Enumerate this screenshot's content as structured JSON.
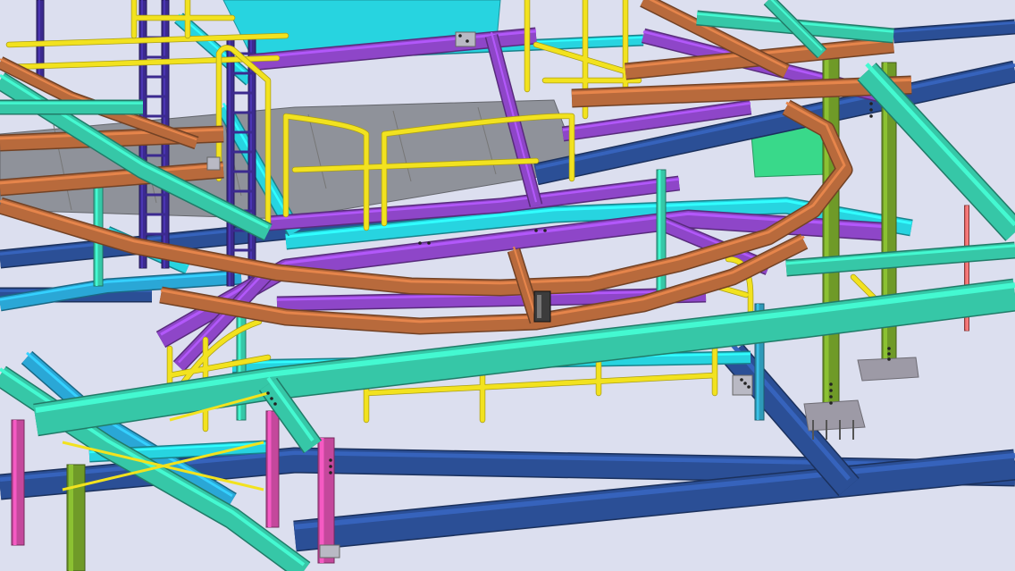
{
  "viewport": {
    "kind": "3D steel structure model view",
    "background_color": "#dcdfef"
  },
  "member_colors": {
    "deck_plate": "#8f929a",
    "handrail": "#f2e21f",
    "curved_beam": "#b86a3c",
    "secondary_beam": "#8e46c8",
    "primary_beam": "#36c7a7",
    "cross_beam": "#27d4e0",
    "base_beam": "#2b4f96",
    "column_olive": "#6f9a28",
    "column_magenta": "#c4489c",
    "ladder_dark": "#3b2a8f",
    "base_plate": "#9d9aa6",
    "rod_red": "#e06666",
    "bracket_green": "#39d98a"
  },
  "icons": [
    "bolt-icon",
    "base-plate-icon",
    "clamp-icon"
  ]
}
